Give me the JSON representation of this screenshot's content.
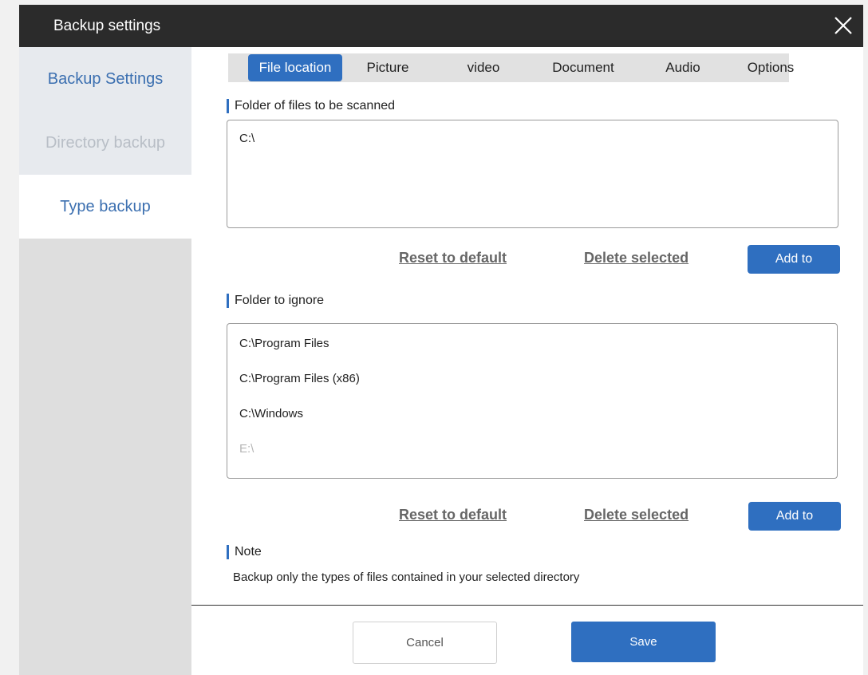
{
  "window": {
    "title": "Backup settings"
  },
  "sidebar": {
    "items": [
      {
        "label": "Backup Settings"
      },
      {
        "label": "Directory backup"
      },
      {
        "label": "Type backup"
      }
    ]
  },
  "tabs": [
    {
      "label": "File location"
    },
    {
      "label": "Picture"
    },
    {
      "label": "video"
    },
    {
      "label": "Document"
    },
    {
      "label": "Audio"
    },
    {
      "label": "Options"
    }
  ],
  "scan_section": {
    "label": "Folder of files to be scanned",
    "items": [
      "C:\\"
    ],
    "reset_label": "Reset to default",
    "delete_label": "Delete selected",
    "add_label": "Add to"
  },
  "ignore_section": {
    "label": "Folder to ignore",
    "items": [
      "C:\\Program Files",
      "C:\\Program Files (x86)",
      "C:\\Windows",
      "E:\\"
    ],
    "reset_label": "Reset to default",
    "delete_label": "Delete selected",
    "add_label": "Add to"
  },
  "note": {
    "label": "Note",
    "text": "Backup only the types of files contained in your selected directory"
  },
  "footer": {
    "cancel_label": "Cancel",
    "save_label": "Save"
  },
  "colors": {
    "accent": "#2f6fc0",
    "titlebar": "#2b2b2b",
    "sidebar": "#dedede",
    "sidebar_item": "#e7eaee"
  },
  "icons": {
    "close": "close-icon"
  }
}
